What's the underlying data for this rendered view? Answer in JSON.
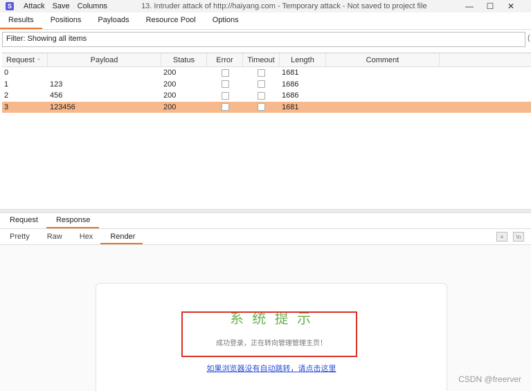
{
  "titlebar": {
    "app_icon_text": "S",
    "menu": [
      "Attack",
      "Save",
      "Columns"
    ],
    "window_title": "13. Intruder attack of http://haiyang.com - Temporary attack - Not saved to project file",
    "minimize": "—",
    "maximize": "☐",
    "close": "✕"
  },
  "tabs": [
    "Results",
    "Positions",
    "Payloads",
    "Resource Pool",
    "Options"
  ],
  "filter": {
    "text": "Filter: Showing all items",
    "edge": "("
  },
  "table": {
    "columns": [
      "Request",
      "Payload",
      "Status",
      "Error",
      "Timeout",
      "Length",
      "Comment"
    ],
    "sort_indicator": "^",
    "rows": [
      {
        "request": "0",
        "payload": "",
        "status": "200",
        "length": "1681"
      },
      {
        "request": "1",
        "payload": "123",
        "status": "200",
        "length": "1686"
      },
      {
        "request": "2",
        "payload": "456",
        "status": "200",
        "length": "1686"
      },
      {
        "request": "3",
        "payload": "123456",
        "status": "200",
        "length": "1681"
      }
    ]
  },
  "subtabs": [
    "Request",
    "Response"
  ],
  "viewtabs": [
    "Pretty",
    "Raw",
    "Hex",
    "Render"
  ],
  "view_icons": [
    "≡",
    "\\n"
  ],
  "render": {
    "title": "系 统 提 示",
    "message": "成功登录，正在转向管理管理主页！",
    "link": "如果浏览器没有自动跳转，请点击这里"
  },
  "watermark": "CSDN @freerver",
  "colors": {
    "accent": "#e8732b",
    "selected_row": "#f7b98b",
    "title_green": "#6ab04c",
    "highlight_red": "#d93025",
    "link_blue": "#2a4fd4"
  }
}
